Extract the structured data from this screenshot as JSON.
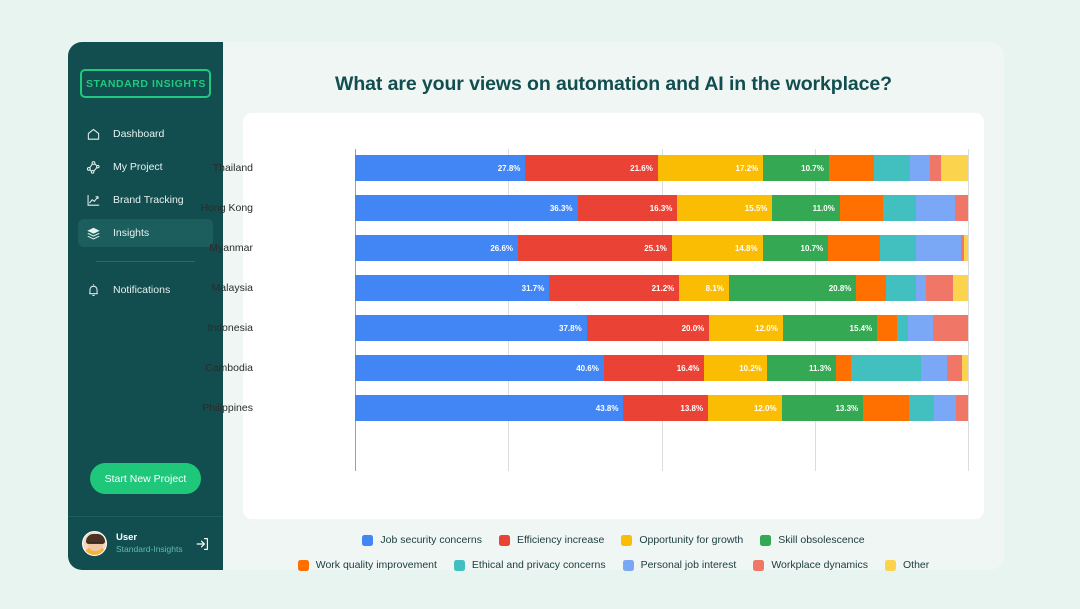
{
  "theme": {
    "page_bg": "#e8f4ef",
    "sidebar_bg": "#124e4f",
    "card_bg": "#f0f6f4",
    "accent_green": "#1fc77b",
    "title_color": "#124e4f"
  },
  "sidebar": {
    "logo": "STANDARD INSIGHTS",
    "items": [
      {
        "label": "Dashboard",
        "icon": "home-icon",
        "active": false
      },
      {
        "label": "My Project",
        "icon": "project-nodes-icon",
        "active": false
      },
      {
        "label": "Brand Tracking",
        "icon": "line-chart-icon",
        "active": false
      },
      {
        "label": "Insights",
        "icon": "layers-icon",
        "active": true
      }
    ],
    "secondary_items": [
      {
        "label": "Notifications",
        "icon": "bell-icon",
        "active": false
      }
    ],
    "cta_label": "Start New Project",
    "user": {
      "name": "User",
      "org": "Standard-Insights",
      "logout_icon": "logout-icon"
    }
  },
  "header": {
    "title": "What are your views on automation and AI in the workplace?"
  },
  "chart_data": {
    "type": "bar",
    "orientation": "horizontal",
    "stacked": true,
    "normalized": true,
    "title": "What are your views on automation and AI in the workplace?",
    "xlabel": "",
    "ylabel": "",
    "xlim": [
      0,
      100
    ],
    "grid": true,
    "gridlines": [
      0,
      25,
      50,
      75,
      100
    ],
    "legend_position": "bottom",
    "categories": [
      "Thailand",
      "Hong Kong",
      "Myanmar",
      "Malaysia",
      "Indonesia",
      "Cambodia",
      "Philippines"
    ],
    "series": [
      {
        "name": "Job security concerns",
        "color": "#4285f4",
        "values": [
          27.8,
          36.3,
          26.6,
          31.7,
          37.8,
          40.6,
          43.8
        ],
        "labels": [
          "27.8%",
          "36.3%",
          "26.6%",
          "31.7%",
          "37.8%",
          "40.6%",
          "43.8%"
        ]
      },
      {
        "name": "Efficiency increase",
        "color": "#ea4335",
        "values": [
          21.6,
          16.3,
          25.1,
          21.2,
          20.0,
          16.4,
          13.8
        ],
        "labels": [
          "21.6%",
          "16.3%",
          "25.1%",
          "21.2%",
          "20.0%",
          "16.4%",
          "13.8%"
        ]
      },
      {
        "name": "Opportunity for growth",
        "color": "#fbbc04",
        "values": [
          17.2,
          15.5,
          14.8,
          8.1,
          12.0,
          10.2,
          12.0
        ],
        "labels": [
          "17.2%",
          "15.5%",
          "14.8%",
          "8.1%",
          "12.0%",
          "10.2%",
          "12.0%"
        ]
      },
      {
        "name": "Skill obsolescence",
        "color": "#34a853",
        "values": [
          10.7,
          11.0,
          10.7,
          20.8,
          15.4,
          11.3,
          13.3
        ],
        "labels": [
          "10.7%",
          "11.0%",
          "10.7%",
          "20.8%",
          "15.4%",
          "11.3%",
          "13.3%"
        ]
      },
      {
        "name": "Work quality improvement",
        "color": "#ff7000",
        "values": [
          7.4,
          7.0,
          8.5,
          4.8,
          3.2,
          2.4,
          7.4
        ],
        "labels": [
          "",
          "",
          "",
          "",
          "",
          "",
          ""
        ]
      },
      {
        "name": "Ethical and privacy concerns",
        "color": "#42bfbf",
        "values": [
          5.8,
          5.5,
          5.8,
          5.0,
          1.9,
          11.5,
          4.2
        ],
        "labels": [
          "",
          "",
          "",
          "",
          "",
          "",
          ""
        ]
      },
      {
        "name": "Personal job interest",
        "color": "#7ba7f7",
        "values": [
          3.3,
          6.3,
          7.3,
          1.6,
          4.0,
          4.2,
          3.5
        ],
        "labels": [
          "",
          "",
          "",
          "",
          "",
          "",
          ""
        ]
      },
      {
        "name": "Workplace dynamics",
        "color": "#f07667",
        "values": [
          1.8,
          2.1,
          0.6,
          4.3,
          5.7,
          2.5,
          2.0
        ],
        "labels": [
          "",
          "",
          "",
          "",
          "",
          "",
          ""
        ]
      },
      {
        "name": "Other",
        "color": "#fcd34d",
        "values": [
          4.4,
          0.0,
          0.6,
          2.5,
          0.0,
          0.9,
          0.0
        ],
        "labels": [
          "",
          "",
          "",
          "",
          "",
          "",
          ""
        ]
      }
    ]
  }
}
